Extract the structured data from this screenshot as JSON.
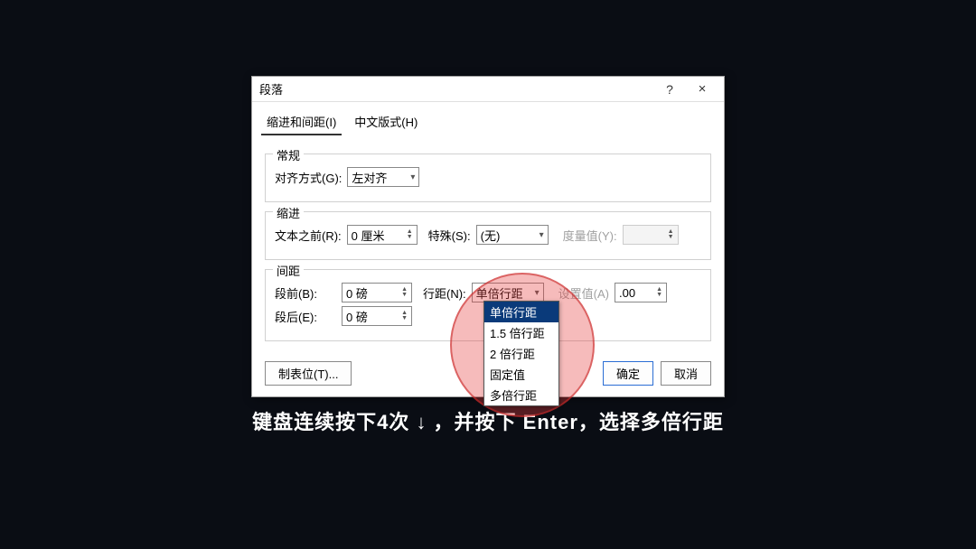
{
  "dialog": {
    "title": "段落",
    "help_tooltip": "?",
    "close_tooltip": "×"
  },
  "tabs": {
    "indent_spacing": "缩进和间距(I)",
    "asian_layout": "中文版式(H)"
  },
  "general": {
    "legend": "常规",
    "alignment_label": "对齐方式(G):",
    "alignment_value": "左对齐"
  },
  "indent": {
    "legend": "缩进",
    "before_text_label": "文本之前(R):",
    "before_text_value": "0 厘米",
    "special_label": "特殊(S):",
    "special_value": "(无)",
    "measure_label": "度量值(Y):",
    "measure_value": ""
  },
  "spacing": {
    "legend": "间距",
    "before_label": "段前(B):",
    "before_value": "0 磅",
    "after_label": "段后(E):",
    "after_value": "0 磅",
    "line_spacing_label": "行距(N):",
    "line_spacing_value": "单倍行距",
    "set_value_label": "设置值(A)",
    "set_value_value": ".00"
  },
  "line_spacing_options": {
    "single": "单倍行距",
    "one_half": "1.5 倍行距",
    "double": "2 倍行距",
    "fixed": "固定值",
    "multiple": "多倍行距"
  },
  "footer": {
    "tabs_button": "制表位(T)...",
    "ok_button": "确定",
    "cancel_button": "取消"
  },
  "caption": "键盘连续按下4次 ↓ ，并按下 Enter，选择多倍行距"
}
